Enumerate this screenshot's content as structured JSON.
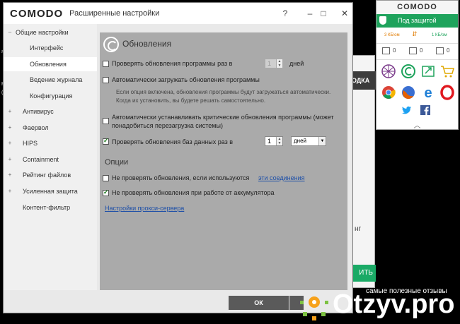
{
  "window": {
    "brand": "COMODO",
    "title": "Расширенные настройки",
    "controls": {
      "help": "?",
      "minimize": "–",
      "maximize": "□",
      "close": "✕"
    }
  },
  "sidebar": {
    "items": [
      {
        "label": "Общие настройки",
        "arrow": "–",
        "level": 0
      },
      {
        "label": "Интерфейс",
        "level": 1
      },
      {
        "label": "Обновления",
        "level": 1,
        "active": true
      },
      {
        "label": "Ведение журнала",
        "level": 1
      },
      {
        "label": "Конфигурация",
        "level": 1
      },
      {
        "label": "Антивирус",
        "arrow": "+",
        "level": 0
      },
      {
        "label": "Фаервол",
        "arrow": "+",
        "level": 0
      },
      {
        "label": "HIPS",
        "arrow": "+",
        "level": 0
      },
      {
        "label": "Containment",
        "arrow": "+",
        "level": 0
      },
      {
        "label": "Рейтинг файлов",
        "arrow": "+",
        "level": 0
      },
      {
        "label": "Усиленная защита",
        "arrow": "+",
        "level": 0
      },
      {
        "label": "Контент-фильтр",
        "level": 0
      }
    ]
  },
  "content": {
    "header": "Обновления",
    "opt_check_program": {
      "label": "Проверять обновления программы раз в",
      "checked": false,
      "value": "1",
      "unit": "дней"
    },
    "opt_auto_download": {
      "label": "Автоматически загружать обновления программы",
      "checked": false
    },
    "note_auto_download": "Если опция включена, обновления программы будут загружаться автоматически.",
    "note_auto_download_2": "Когда их установить, вы будете решать самостоятельно.",
    "opt_auto_install": {
      "label": "Автоматически устанавливать критические обновления программы (может",
      "label_2": "понадобиться перезагрузка системы)",
      "checked": false
    },
    "opt_check_db": {
      "label": "Проверять обновления баз данных раз в",
      "checked": true,
      "value": "1",
      "unit": "дней"
    },
    "options_section": "Опции",
    "opt_no_check_connections": {
      "label": "Не проверять обновления, если используются",
      "link": "эти соединения",
      "checked": false
    },
    "opt_no_check_battery": {
      "label": "Не проверять обновления при работе от аккумулятора",
      "checked": true
    },
    "proxy_link": "Настройки прокси-сервера"
  },
  "buttons": {
    "ok": "ОК"
  },
  "background_dialog": {
    "button_fragment": "ОДКА",
    "text_fragment": "нг",
    "green_button_fragment": "ИТЬ"
  },
  "desktop_left": [
    "я",
    "P",
    "(С"
  ],
  "widget": {
    "brand": "COMODO",
    "status": "Под защитой",
    "traffic_in": "3 КБ/ом",
    "traffic_out": "1 КБ/ом",
    "counts": [
      "0",
      "0",
      "0"
    ],
    "status_color": "#1ea35c"
  },
  "watermark": {
    "text": "самые полезные отзывы",
    "brand": "Otzyv.pro"
  }
}
